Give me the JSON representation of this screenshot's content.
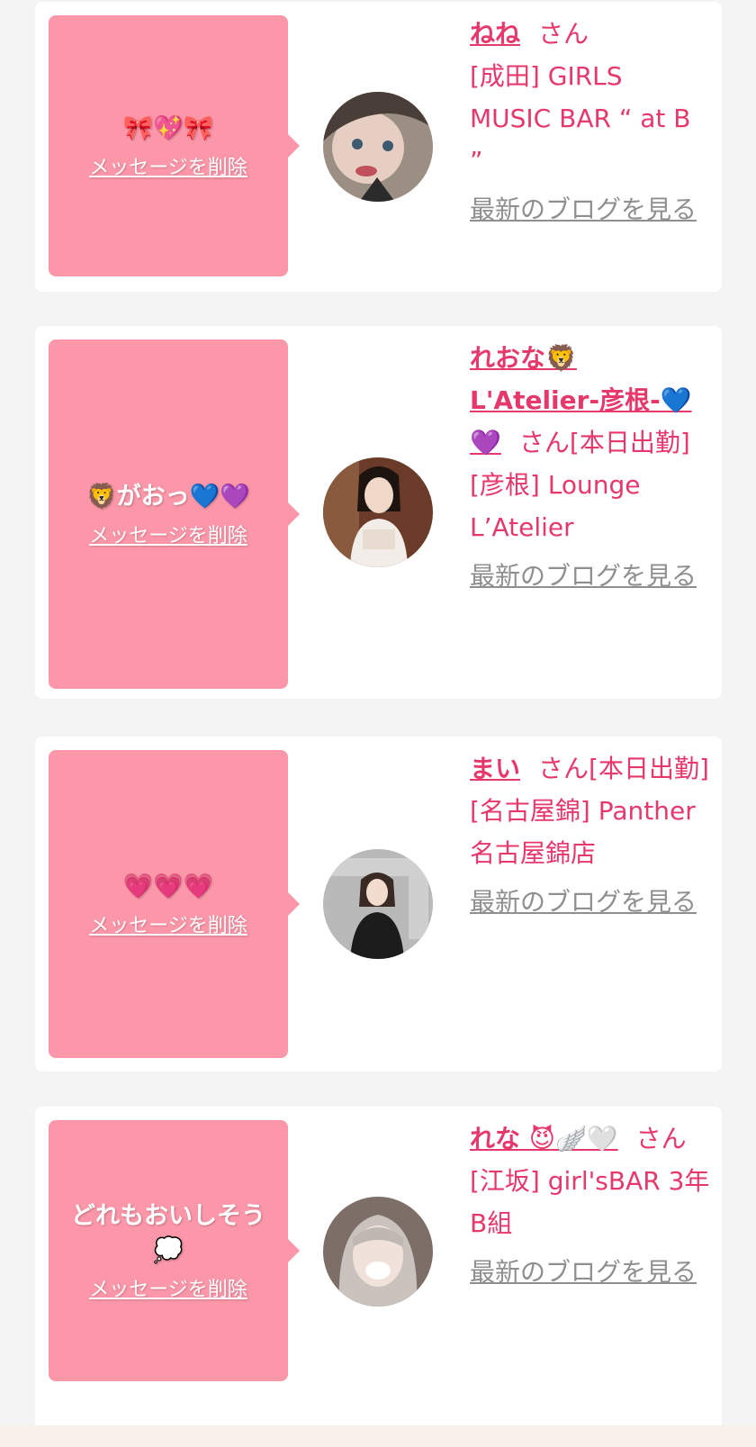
{
  "cards": [
    {
      "message": "🎀💖🎀",
      "delete_label": "メッセージを削除",
      "name": "ねね",
      "honorific": "さん",
      "status": "",
      "shop": "[成田] GIRLS MUSIC BAR “ at B ”",
      "blog_label": "最新のブログを見る",
      "avatar": "avatar-photo-1"
    },
    {
      "message": "🦁がおっ💙💜",
      "delete_label": "メッセージを削除",
      "name": "れおな🦁 L'Atelier-彦根-💙💜",
      "honorific": "さん",
      "status": "[本日出勤]",
      "shop": "[彦根] Lounge L’Atelier",
      "blog_label": "最新のブログを見る",
      "avatar": "avatar-photo-2"
    },
    {
      "message": "💗💗💗",
      "delete_label": "メッセージを削除",
      "name": "まい",
      "honorific": "さん",
      "status": "[本日出勤]",
      "shop": "[名古屋錦] Panther 名古屋錦店",
      "blog_label": "最新のブログを見る",
      "avatar": "avatar-photo-3"
    },
    {
      "message": "どれもおいしそう💭",
      "delete_label": "メッセージを削除",
      "name": "れな 😈🪽🤍",
      "honorific": "さん",
      "status": "",
      "shop": "[江坂] girl'sBAR 3年B組",
      "blog_label": "最新のブログを見る",
      "avatar": "avatar-photo-4"
    }
  ],
  "colors": {
    "accent": "#e7386b",
    "bubble": "#fc97a9",
    "link_gray": "#8f8f8f"
  }
}
